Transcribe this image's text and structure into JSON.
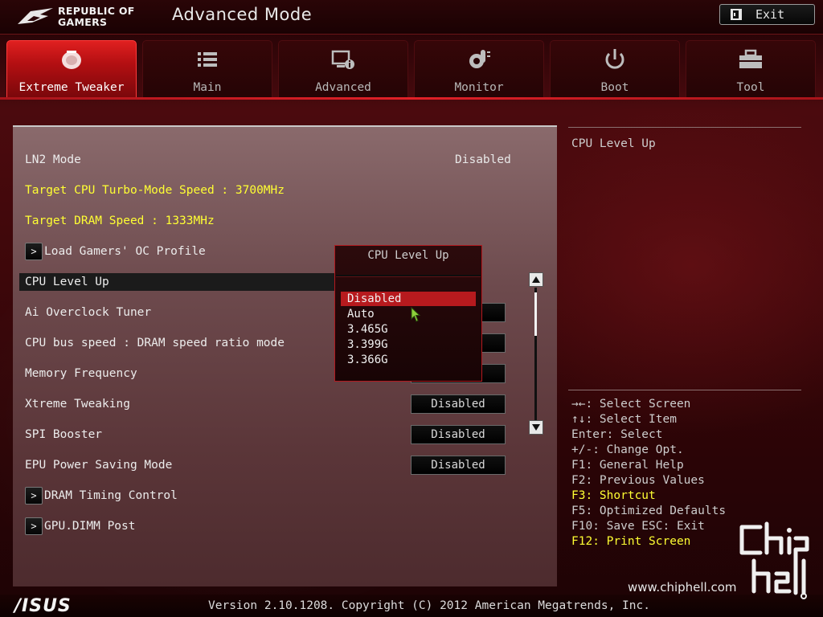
{
  "header": {
    "brand_line1": "REPUBLIC OF",
    "brand_line2": "GAMERS",
    "title": "Advanced Mode",
    "exit_label": "Exit"
  },
  "tabs": [
    {
      "label": "Extreme Tweaker",
      "icon": "extreme-tweaker-icon",
      "active": true
    },
    {
      "label": "Main",
      "icon": "list-icon",
      "active": false
    },
    {
      "label": "Advanced",
      "icon": "advanced-info-icon",
      "active": false
    },
    {
      "label": "Monitor",
      "icon": "thermometer-icon",
      "active": false
    },
    {
      "label": "Boot",
      "icon": "power-icon",
      "active": false
    },
    {
      "label": "Tool",
      "icon": "toolbox-icon",
      "active": false
    }
  ],
  "settings": {
    "ln2_mode": {
      "label": "LN2 Mode",
      "value": "Disabled"
    },
    "target_cpu": "Target CPU Turbo-Mode Speed : 3700MHz",
    "target_dram": "Target DRAM Speed : 1333MHz",
    "load_oc_profile": "Load Gamers' OC Profile",
    "cpu_level_up": "CPU Level Up",
    "ai_overclock_tuner": "Ai Overclock Tuner",
    "cpu_bus_speed": "CPU bus speed : DRAM speed ratio mode",
    "memory_frequency": "Memory Frequency",
    "xtreme_tweaking": {
      "label": "Xtreme Tweaking",
      "value": "Disabled"
    },
    "spi_booster": {
      "label": "SPI Booster",
      "value": "Disabled"
    },
    "epu_power_saving": {
      "label": "EPU Power Saving Mode",
      "value": "Disabled"
    },
    "dram_timing": "DRAM Timing Control",
    "gpu_dimm_post": "GPU.DIMM Post",
    "submenu_arrow": ">"
  },
  "dropdown": {
    "title": "CPU Level Up",
    "options": [
      "Disabled",
      "Auto",
      "3.465G",
      "3.399G",
      "3.366G"
    ],
    "selected": "Disabled"
  },
  "help": {
    "title": "CPU Level Up",
    "keys": [
      {
        "text": "→←: Select Screen",
        "highlight": false
      },
      {
        "text": "↑↓: Select Item",
        "highlight": false
      },
      {
        "text": "Enter: Select",
        "highlight": false
      },
      {
        "text": "+/-: Change Opt.",
        "highlight": false
      },
      {
        "text": "F1: General Help",
        "highlight": false
      },
      {
        "text": "F2: Previous Values",
        "highlight": false
      },
      {
        "text": "F3: Shortcut",
        "highlight": true
      },
      {
        "text": "F5: Optimized Defaults",
        "highlight": false
      },
      {
        "text": "F10: Save  ESC: Exit",
        "highlight": false
      },
      {
        "text": "F12: Print Screen",
        "highlight": true
      }
    ]
  },
  "footer": {
    "brand": "/ISUS",
    "version": "Version 2.10.1208. Copyright (C) 2012 American Megatrends, Inc.",
    "watermark": "www.chiphell.com"
  },
  "colors": {
    "accent_red": "#e02027",
    "highlight_yellow": "#ffff33",
    "selection_red": "#b71a1e"
  }
}
